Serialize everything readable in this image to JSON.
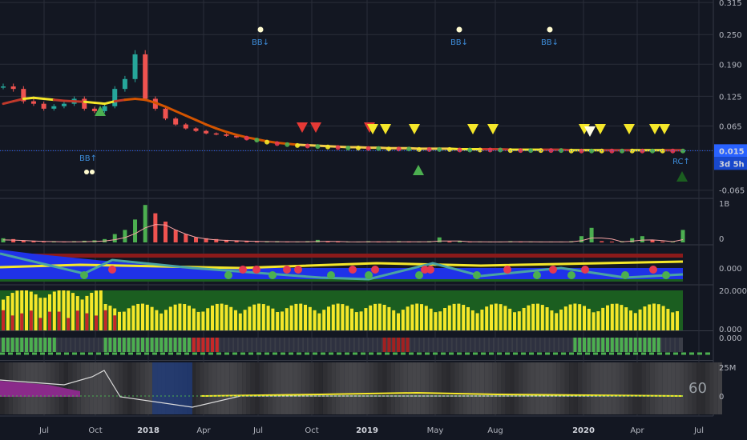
{
  "colors": {
    "background": "#131722",
    "grid": "#2a2e39",
    "up": "#26a69a",
    "down": "#ef5350",
    "yellow": "#f5e72a",
    "blue": "#1f32e8",
    "green": "#1b5e20",
    "red": "#8b1a1a",
    "price_line": "#2962ff",
    "label_blue": "#2962ff"
  },
  "chart_data": [
    {
      "type": "line",
      "panel": "price",
      "y_ticks": [
        "0.315",
        "0.250",
        "0.190",
        "0.125",
        "0.065",
        "0.015",
        "-0.065"
      ],
      "y_tick_values": [
        0.315,
        0.25,
        0.19,
        0.125,
        0.065,
        0.015,
        -0.065
      ],
      "ylim": [
        -0.08,
        0.32
      ],
      "x_ticks": [
        "Jul",
        "Oct",
        "2018",
        "Apr",
        "Jul",
        "Oct",
        "2019",
        "May",
        "Aug",
        "2020",
        "Apr",
        "Jul"
      ],
      "bold_x_ticks": [
        "2018",
        "2019",
        "2020"
      ],
      "last_price_label": "0.015",
      "countdown_label": "3d 5h",
      "series": [
        {
          "values": [
            0.145,
            0.14,
            0.115,
            0.11,
            0.1,
            0.105,
            0.11,
            0.12,
            0.1,
            0.095,
            0.105,
            0.14,
            0.16,
            0.21,
            0.12,
            0.1,
            0.08,
            0.068,
            0.06,
            0.055,
            0.05,
            0.048,
            0.045,
            0.042,
            0.038,
            0.035,
            0.033,
            0.03,
            0.028,
            0.027,
            0.026,
            0.025,
            0.025,
            0.024,
            0.023,
            0.022,
            0.022,
            0.021,
            0.021,
            0.02,
            0.02,
            0.02,
            0.02,
            0.019,
            0.019,
            0.019,
            0.018,
            0.018,
            0.018,
            0.018,
            0.018,
            0.017,
            0.017,
            0.017,
            0.017,
            0.017,
            0.016,
            0.016,
            0.016,
            0.016,
            0.016,
            0.016,
            0.015,
            0.015,
            0.015,
            0.016,
            0.015,
            0.015
          ]
        },
        {
          "values": [
            0.11,
            0.115,
            0.12,
            0.122,
            0.12,
            0.118,
            0.116,
            0.115,
            0.114,
            0.112,
            0.11,
            0.115,
            0.118,
            0.12,
            0.118,
            0.112,
            0.104,
            0.095,
            0.086,
            0.077,
            0.068,
            0.06,
            0.053,
            0.047,
            0.042,
            0.038,
            0.034,
            0.031,
            0.029,
            0.027,
            0.026,
            0.025,
            0.024,
            0.023,
            0.022,
            0.022,
            0.021,
            0.021,
            0.02,
            0.02,
            0.02,
            0.019,
            0.019,
            0.019,
            0.019,
            0.018,
            0.018,
            0.018,
            0.018,
            0.018,
            0.017,
            0.017,
            0.017,
            0.017,
            0.017,
            0.017,
            0.016,
            0.016,
            0.016,
            0.016,
            0.016,
            0.016,
            0.016,
            0.016,
            0.016,
            0.016,
            0.016,
            0.016
          ]
        }
      ],
      "annotations": [
        "BB↓",
        "BB↓",
        "BB↓",
        "BB↑",
        "RC↑"
      ]
    },
    {
      "type": "bar",
      "panel": "volume",
      "y_ticks": [
        "1B",
        "0"
      ],
      "ylim": [
        0,
        1
      ],
      "values": [
        0.1,
        0.08,
        0.05,
        0.04,
        0.03,
        0.03,
        0.02,
        0.03,
        0.04,
        0.05,
        0.08,
        0.2,
        0.3,
        0.55,
        0.9,
        0.7,
        0.5,
        0.3,
        0.2,
        0.12,
        0.1,
        0.08,
        0.06,
        0.05,
        0.04,
        0.03,
        0.03,
        0.03,
        0.02,
        0.02,
        0.03,
        0.06,
        0.03,
        0.02,
        0.02,
        0.02,
        0.03,
        0.02,
        0.02,
        0.03,
        0.02,
        0.02,
        0.03,
        0.12,
        0.02,
        0.03,
        0.02,
        0.02,
        0.02,
        0.02,
        0.03,
        0.02,
        0.02,
        0.02,
        0.02,
        0.02,
        0.03,
        0.15,
        0.35,
        0.03,
        0.02,
        0.03,
        0.1,
        0.15,
        0.05,
        0.02,
        0.02,
        0.3
      ]
    },
    {
      "type": "area",
      "panel": "oscillator",
      "y_ticks": [
        "0.000"
      ]
    },
    {
      "type": "bar",
      "panel": "strength",
      "y_ticks": [
        "20.000",
        "0.000"
      ],
      "ylim": [
        0,
        20
      ]
    },
    {
      "type": "bar",
      "panel": "squeeze",
      "y_ticks": [
        "0.000"
      ]
    },
    {
      "type": "area",
      "panel": "bottom",
      "y_ticks": [
        "25M",
        "0"
      ],
      "overlay_value": "60"
    }
  ]
}
